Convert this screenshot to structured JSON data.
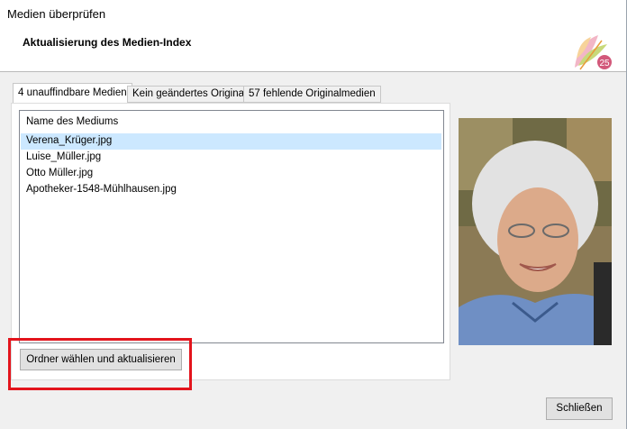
{
  "window": {
    "title": "Medien überprüfen"
  },
  "header": {
    "title": "Aktualisierung des Medien-Index",
    "logo_text": "25"
  },
  "tabs": [
    {
      "label": "4 unauffindbare Medien",
      "active": true
    },
    {
      "label": "Kein geändertes Original",
      "active": false
    },
    {
      "label": "57 fehlende Originalmedien",
      "active": false
    }
  ],
  "list": {
    "column_header": "Name des Mediums",
    "items": [
      {
        "name": "Verena_Krüger.jpg",
        "selected": true
      },
      {
        "name": "Luise_Müller.jpg",
        "selected": false
      },
      {
        "name": "Otto Müller.jpg",
        "selected": false
      },
      {
        "name": "Apotheker-1548-Mühlhausen.jpg",
        "selected": false
      }
    ]
  },
  "actions": {
    "choose_folder_label": "Ordner wählen und aktualisieren"
  },
  "preview": {
    "icon": "portrait-photo-preview"
  },
  "footer": {
    "close_label": "Schließen"
  },
  "colors": {
    "selection": "#cce8ff",
    "highlight_frame": "#e3141c",
    "button_face": "#e1e1e1"
  }
}
